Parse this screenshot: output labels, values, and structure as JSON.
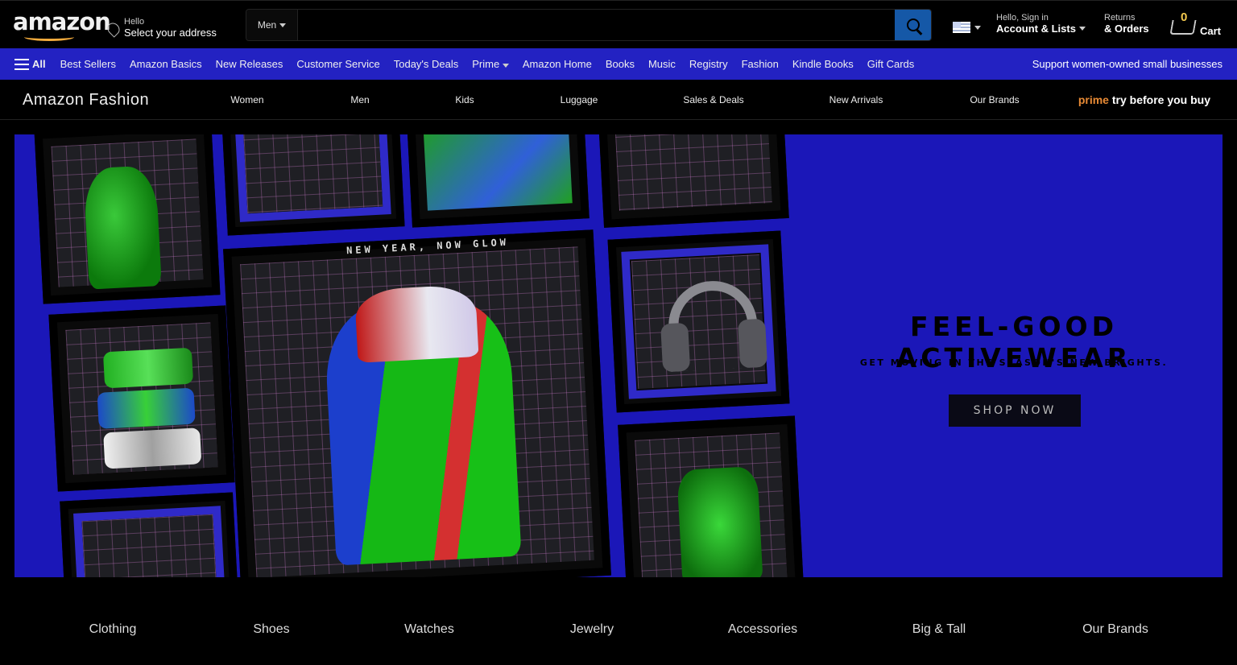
{
  "header": {
    "logo_text": "amazon",
    "deliver_line1": "Hello",
    "deliver_line2": "Select your address",
    "search_category": "Men",
    "search_placeholder": "",
    "account_line1": "Hello, Sign in",
    "account_line2": "Account & Lists",
    "returns_line1": "Returns",
    "returns_line2": "& Orders",
    "cart_count": "0",
    "cart_label": "Cart"
  },
  "subnav": {
    "all_label": "All",
    "items": [
      "Best Sellers",
      "Amazon Basics",
      "New Releases",
      "Customer Service",
      "Today's Deals",
      "Prime",
      "Amazon Home",
      "Books",
      "Music",
      "Registry",
      "Fashion",
      "Kindle Books",
      "Gift Cards"
    ],
    "promo": "Support women-owned small businesses"
  },
  "fashion_nav": {
    "title": "Amazon Fashion",
    "links": [
      "Women",
      "Men",
      "Kids",
      "Luggage",
      "Sales & Deals",
      "New Arrivals",
      "Our Brands"
    ],
    "prime_word": "prime",
    "prime_rest": "try before you buy"
  },
  "hero": {
    "collage_tag": "NEW YEAR, NOW GLOW",
    "title": "FEEL-GOOD ACTIVEWEAR",
    "subtitle": "GET MOVING IN THE SEASON'S NEW BRIGHTS.",
    "cta": "SHOP NOW"
  },
  "categories": [
    "Clothing",
    "Shoes",
    "Watches",
    "Jewelry",
    "Accessories",
    "Big & Tall",
    "Our Brands"
  ],
  "colors": {
    "subnav_bg": "#2322c2",
    "hero_bg": "#1b17b8",
    "search_button": "#1558a7",
    "prime_accent": "#e88a35"
  }
}
